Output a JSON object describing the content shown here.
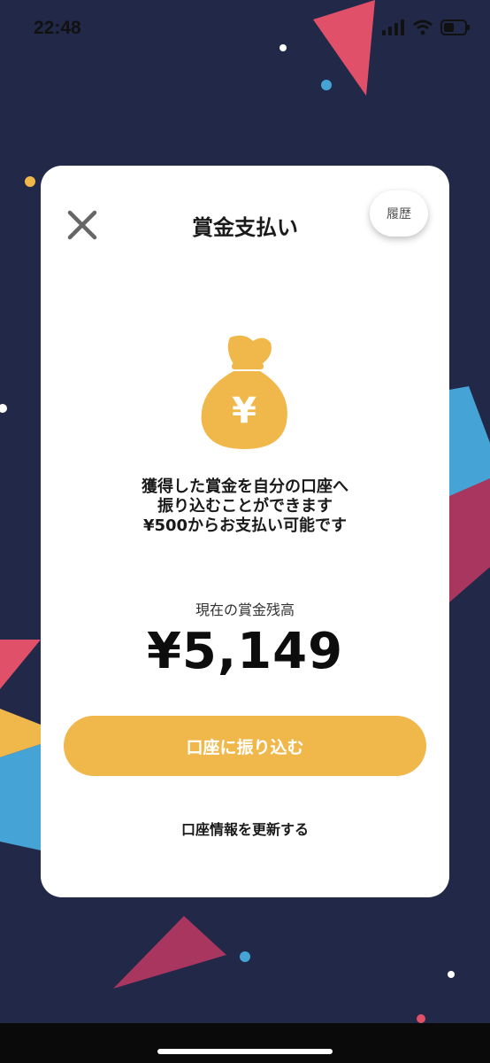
{
  "status_bar": {
    "time": "22:48"
  },
  "card": {
    "title": "賞金支払い",
    "history_label": "履歴",
    "description_lines": [
      "獲得した賞金を自分の口座へ",
      "振り込むことができます",
      "¥500からお支払い可能です"
    ],
    "balance_label": "現在の賞金残高",
    "balance_value": "¥5,149",
    "transfer_button": "口座に振り込む",
    "update_link": "口座情報を更新する",
    "bag_symbol": "¥"
  },
  "colors": {
    "background": "#222848",
    "accent": "#f0b84a",
    "decor_red": "#e05068",
    "decor_blue": "#45a3d6",
    "decor_magenta": "#a8365e"
  },
  "icons": [
    "close-icon",
    "money-bag-icon",
    "signal-icon",
    "wifi-icon",
    "battery-icon"
  ]
}
